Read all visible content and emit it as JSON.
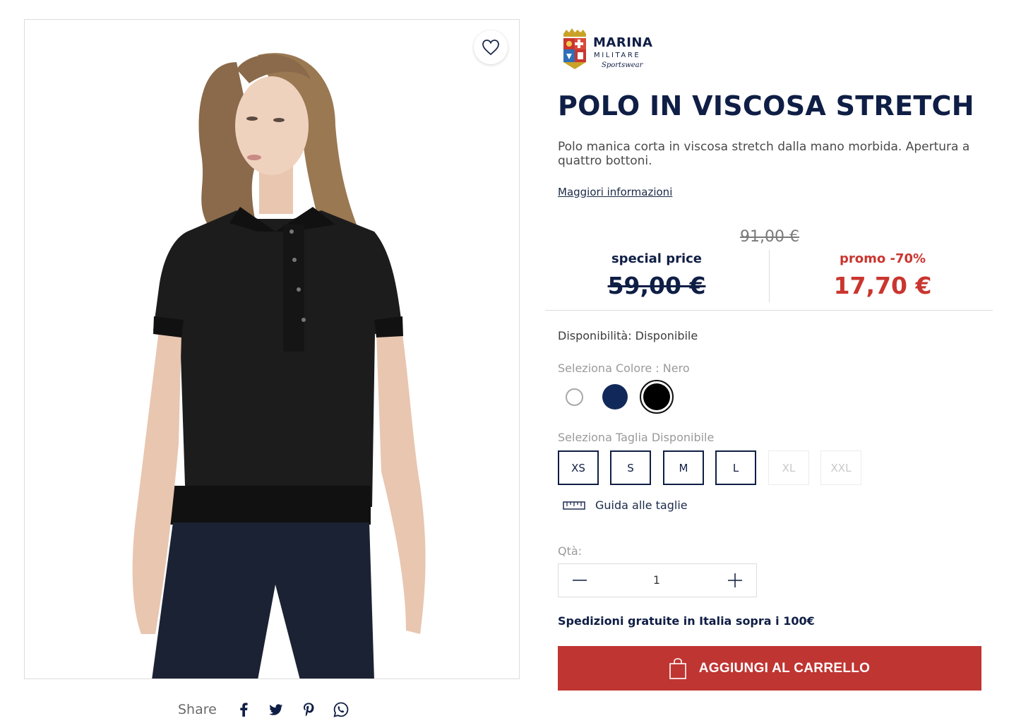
{
  "product": {
    "brand_logo": {
      "line1": "MARINA",
      "line2": "MILITARE",
      "line3": "Sportswear"
    },
    "title": "POLO IN VISCOSA STRETCH",
    "description": "Polo manica corta in viscosa stretch dalla mano morbida. Apertura a quattro bottoni.",
    "more_info_link": "Maggiori informazioni"
  },
  "pricing": {
    "original_price": "91,00 €",
    "special_label": "special price",
    "special_price": "59,00 €",
    "promo_label": "promo -70%",
    "promo_price": "17,70 €",
    "promo_color": "#c9362f"
  },
  "availability": "Disponibilità: Disponibile",
  "color_select": {
    "label": "Seleziona Colore : Nero",
    "swatches": [
      {
        "name": "Bianco",
        "hex": "#ffffff"
      },
      {
        "name": "Blu",
        "hex": "#11295a"
      },
      {
        "name": "Nero",
        "hex": "#000000",
        "selected": true
      }
    ]
  },
  "size_select": {
    "label": "Seleziona Taglia Disponibile",
    "sizes": [
      {
        "label": "XS",
        "available": true
      },
      {
        "label": "S",
        "available": true
      },
      {
        "label": "M",
        "available": true
      },
      {
        "label": "L",
        "available": true
      },
      {
        "label": "XL",
        "available": false
      },
      {
        "label": "XXL",
        "available": false
      }
    ],
    "guide_label": "Guida alle taglie"
  },
  "quantity": {
    "label": "Qtà:",
    "value": "1"
  },
  "shipping_note": "Spedizioni gratuite in Italia sopra i 100€",
  "cart_button": {
    "label": "AGGIUNGI AL CARRELLO",
    "color": "#bf3532"
  },
  "share": {
    "label": "Share",
    "networks": [
      "facebook-icon",
      "twitter-icon",
      "pinterest-icon",
      "whatsapp-icon"
    ]
  }
}
